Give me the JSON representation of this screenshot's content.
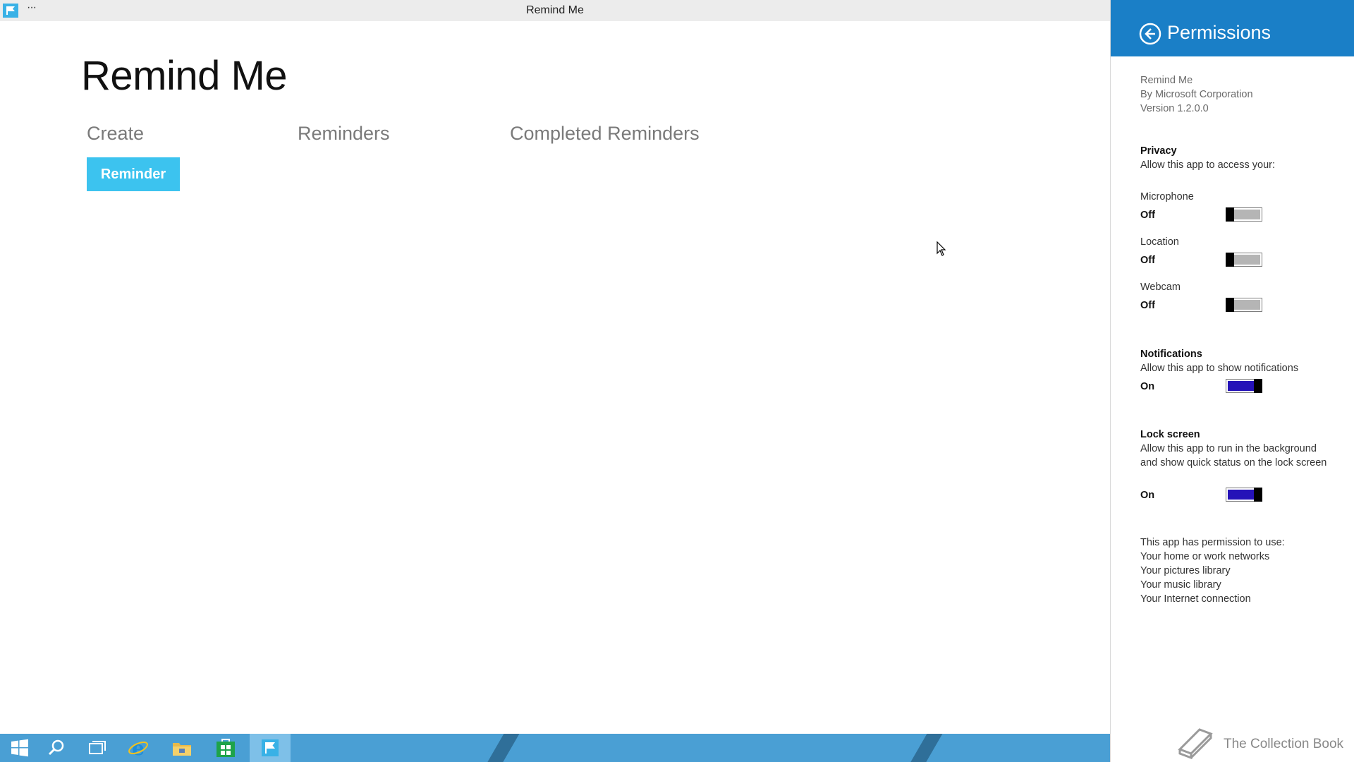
{
  "window": {
    "title": "Remind Me",
    "menu_dots": "···"
  },
  "main": {
    "page_title": "Remind Me",
    "sections": {
      "create": "Create",
      "reminders": "Reminders",
      "completed": "Completed Reminders"
    },
    "reminder_button_label": "Reminder"
  },
  "permissions": {
    "title": "Permissions",
    "app_name": "Remind Me",
    "publisher": "By Microsoft Corporation",
    "version": "Version 1.2.0.0",
    "privacy": {
      "heading": "Privacy",
      "subtext": "Allow this app to access your:",
      "items": [
        {
          "label": "Microphone",
          "state": "Off"
        },
        {
          "label": "Location",
          "state": "Off"
        },
        {
          "label": "Webcam",
          "state": "Off"
        }
      ]
    },
    "notifications": {
      "heading": "Notifications",
      "subtext": "Allow this app to show notifications",
      "state": "On"
    },
    "lock_screen": {
      "heading": "Lock screen",
      "subtext": "Allow this app to run in the background and show quick status on the lock screen",
      "state": "On"
    },
    "capabilities": {
      "heading": "This app has permission to use:",
      "items": [
        "Your home or work networks",
        "Your pictures library",
        "Your music library",
        "Your Internet connection"
      ]
    }
  },
  "watermark": {
    "label": "The Collection Book"
  },
  "colors": {
    "accent_header": "#1a7fc7",
    "button": "#3cc3ef",
    "toggle_on": "#2512b8",
    "taskbar": "#4a9fd4"
  },
  "taskbar": {
    "icons": [
      "windows-start-icon",
      "search-icon",
      "task-view-icon",
      "internet-explorer-icon",
      "file-explorer-icon",
      "store-icon",
      "remind-me-flag-icon"
    ]
  }
}
